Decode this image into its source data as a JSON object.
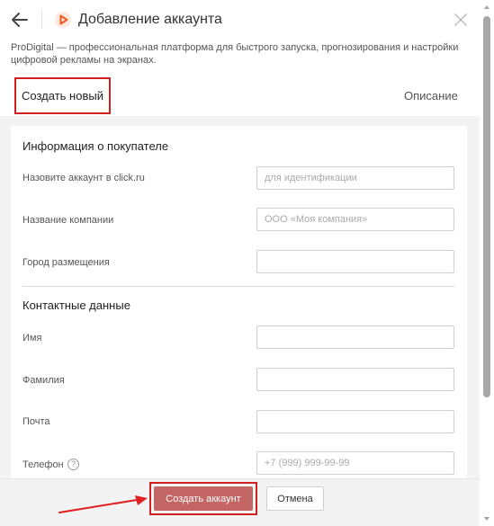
{
  "header": {
    "title": "Добавление аккаунта",
    "back_icon": "arrow-left-icon",
    "logo_icon": "play-logo-icon",
    "close_icon": "close-icon",
    "brand_color": "#ee5a24"
  },
  "description": "ProDigital — профессиональная платформа для быстрого запуска, прогнозирования и настройки цифровой рекламы на экранах.",
  "tabs": {
    "create_new": "Создать новый",
    "description": "Описание"
  },
  "form": {
    "buyer_section_title": "Информация о покупателе",
    "contact_section_title": "Контактные данные",
    "fields": {
      "account_name": {
        "label": "Назовите аккаунт в click.ru",
        "placeholder": "для идентификации",
        "value": ""
      },
      "company_name": {
        "label": "Название компании",
        "placeholder": "ООО «Моя компания»",
        "value": ""
      },
      "city": {
        "label": "Город размещения",
        "placeholder": "",
        "value": ""
      },
      "first_name": {
        "label": "Имя",
        "placeholder": "",
        "value": ""
      },
      "last_name": {
        "label": "Фамилия",
        "placeholder": "",
        "value": ""
      },
      "email": {
        "label": "Почта",
        "placeholder": "",
        "value": ""
      },
      "phone": {
        "label": "Телефон",
        "placeholder": "+7 (999) 999-99-99",
        "value": "",
        "help_icon": "question-circle-icon"
      }
    }
  },
  "footer": {
    "create_label": "Создать аккаунт",
    "cancel_label": "Отмена",
    "create_color": "#c56666"
  },
  "annotation": {
    "highlight_color": "#d21f1f",
    "arrow_icon": "red-arrow-icon"
  }
}
